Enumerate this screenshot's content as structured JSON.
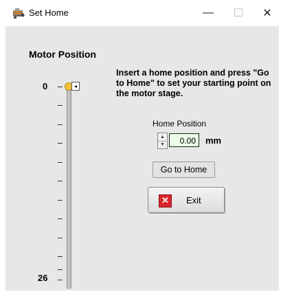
{
  "window": {
    "title": "Set Home",
    "minimize_glyph": "—",
    "maximize_glyph": "☐",
    "close_glyph": "✕",
    "icon": "motor-app-icon"
  },
  "motor": {
    "label": "Motor Position",
    "scale_min": "0",
    "scale_max": "26",
    "value": 0,
    "thumb_marker": "◂"
  },
  "instructions": "Insert a home position and press \"Go to Home\" to set your starting point on the motor stage.",
  "home": {
    "label": "Home Position",
    "value": "0.00",
    "unit": "mm",
    "spin_up": "▲",
    "spin_down": "▼"
  },
  "buttons": {
    "goto_label": "Go to Home",
    "exit_label": "Exit",
    "exit_icon_glyph": "✕"
  },
  "colors": {
    "panel_bg": "#e7e7e7",
    "field_bg": "#eafbe6",
    "thumb": "#f2c23a",
    "exit_icon": "#d9262c"
  }
}
